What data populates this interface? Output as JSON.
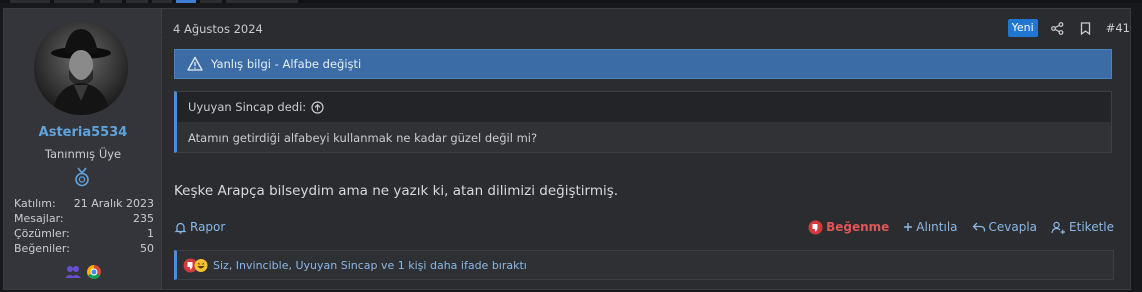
{
  "user": {
    "name": "Asteria5534",
    "title": "Tanınmış Üye",
    "stats": [
      {
        "label": "Katılım:",
        "value": "21 Aralık 2023"
      },
      {
        "label": "Mesajlar:",
        "value": "235"
      },
      {
        "label": "Çözümler:",
        "value": "1"
      },
      {
        "label": "Beğeniler:",
        "value": "50"
      }
    ]
  },
  "post": {
    "date": "4 Ağustos 2024",
    "new_badge": "Yeni",
    "number": "#41",
    "notice": "Yanlış bilgi - Alfabe değişti",
    "quote_author": "Uyuyan Sincap dedi:",
    "quote_text": "Atamın getirdiği alfabeyi kullanmak ne kadar güzel değil mi?",
    "message": "Keşke Arapça bilseydim ama ne yazık ki, atan dilimizi değiştirmiş."
  },
  "actions": {
    "report": "Rapor",
    "dislike": "Beğenme",
    "quote": "Alıntıla",
    "reply": "Cevapla",
    "tag": "Etiketle"
  },
  "reactions": {
    "text": "Siz, Invincible, Uyuyan Sincap ve 1 kişi daha ifade bıraktı"
  },
  "colors": {
    "accent": "#1f77d1",
    "username": "#5fa3dc",
    "notice_bg": "#3b6ca5",
    "dislike": "#e05555"
  }
}
